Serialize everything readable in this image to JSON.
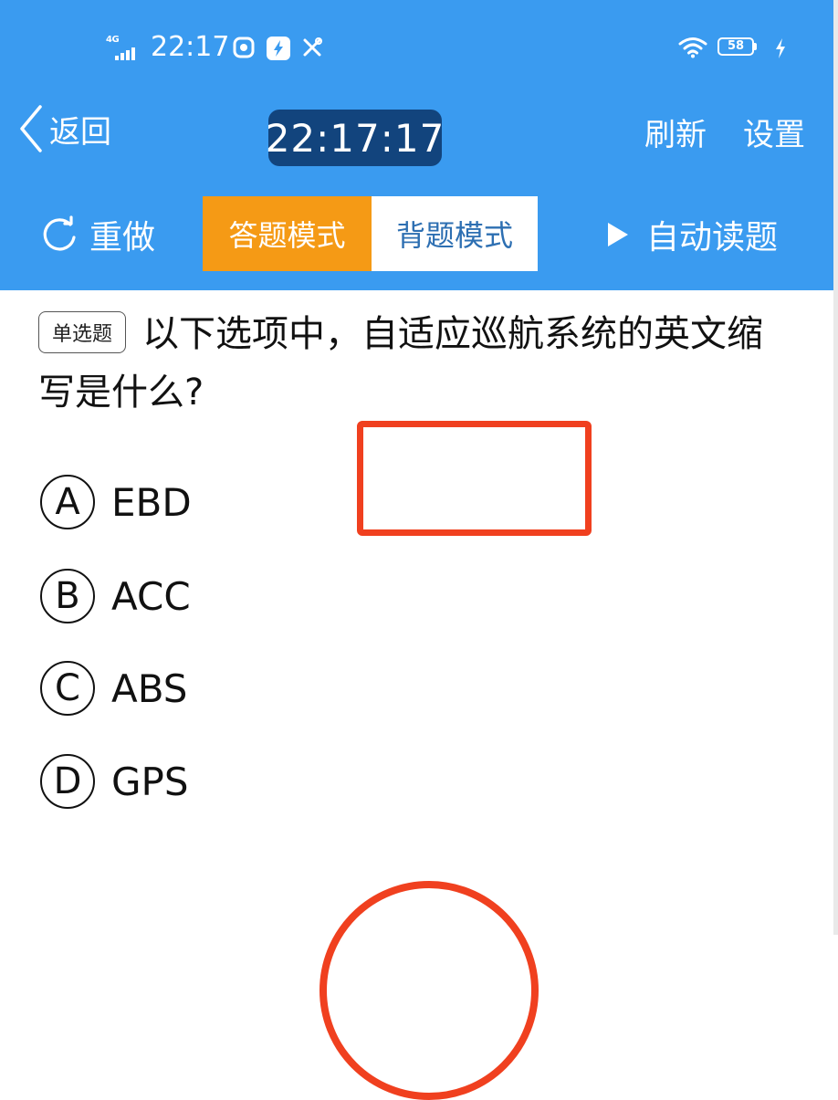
{
  "status_bar": {
    "network": "4G",
    "time": "22:17",
    "battery": "58",
    "icons": [
      "signal-icon",
      "screen-record-icon",
      "flash-app-icon",
      "tools-icon",
      "wifi-icon",
      "battery-icon",
      "charging-icon"
    ]
  },
  "nav": {
    "back_label": "返回",
    "timer": "22:17:17",
    "refresh_label": "刷新",
    "settings_label": "设置"
  },
  "toolbar": {
    "redo_label": "重做",
    "mode_answer": "答题模式",
    "mode_recite": "背题模式",
    "active_mode": "答题模式",
    "auto_read_label": "自动读题"
  },
  "question": {
    "type_tag": "单选题",
    "text": "以下选项中，自适应巡航系统的英文缩写是什么?",
    "options": [
      {
        "letter": "A",
        "text": "EBD"
      },
      {
        "letter": "B",
        "text": "ACC"
      },
      {
        "letter": "C",
        "text": "ABS"
      },
      {
        "letter": "D",
        "text": "GPS"
      }
    ]
  },
  "colors": {
    "header_bg": "#3a9bf0",
    "timer_bg": "#12447d",
    "active_tab": "#f59a15",
    "inactive_tab_text": "#2d6fb2",
    "annotation_red": "#f0401f"
  }
}
